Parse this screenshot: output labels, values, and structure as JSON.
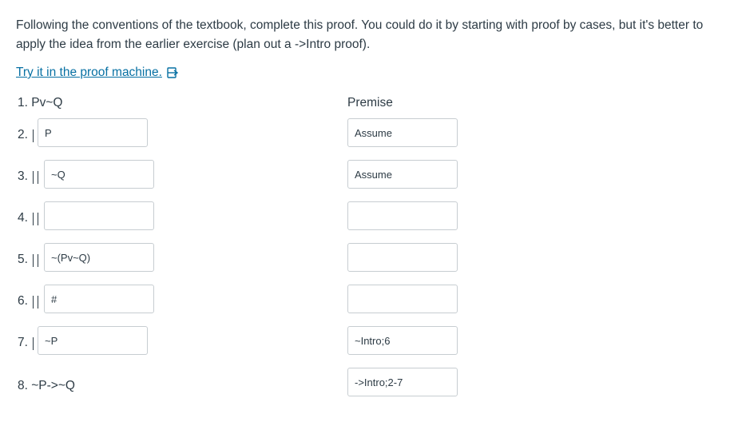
{
  "instructions": "Following the conventions of the textbook, complete this proof. You could do it by starting with proof by cases, but it's better to apply the idea from the earlier exercise (plan out a ->Intro proof).",
  "link": {
    "label": "Try it in the proof machine.",
    "icon": "external-link-icon"
  },
  "premise": {
    "line": "1. Pv~Q",
    "justification": "Premise"
  },
  "rows": [
    {
      "num": "2.",
      "formula": "P",
      "justification": "Assume"
    },
    {
      "num": "3.",
      "formula": "~Q",
      "justification": "Assume"
    },
    {
      "num": "4.",
      "formula": "",
      "justification": ""
    },
    {
      "num": "5.",
      "formula": "~(Pv~Q)",
      "justification": ""
    },
    {
      "num": "6.",
      "formula": "#",
      "justification": ""
    },
    {
      "num": "7.",
      "formula": "~P",
      "justification": "~Intro;6"
    }
  ],
  "conclusion": {
    "line": "8. ~P->~Q",
    "justification": "->Intro;2-7"
  }
}
